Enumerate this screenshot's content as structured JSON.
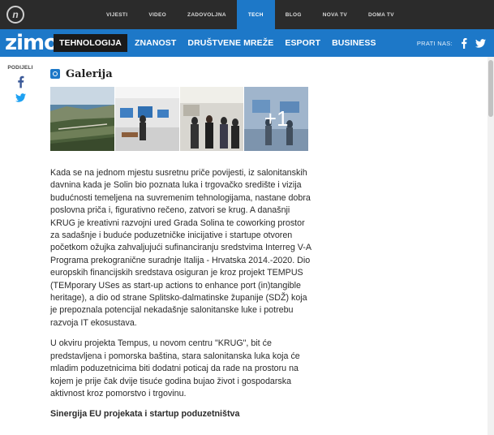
{
  "network": {
    "logo_text": "n",
    "links": [
      {
        "label": "VIJESTI",
        "active": false
      },
      {
        "label": "VIDEO",
        "active": false
      },
      {
        "label": "ZADOVOLJNA",
        "active": false
      },
      {
        "label": "TECH",
        "active": true
      },
      {
        "label": "BLOG",
        "active": false
      },
      {
        "label": "NOVA TV",
        "active": false
      },
      {
        "label": "DOMA TV",
        "active": false
      }
    ]
  },
  "header": {
    "brand": "zimo",
    "sections": [
      {
        "label": "TEHNOLOGIJA",
        "active": true
      },
      {
        "label": "ZNANOST",
        "active": false
      },
      {
        "label": "DRUŠTVENE MREŽE",
        "active": false
      },
      {
        "label": "ESPORT",
        "active": false
      },
      {
        "label": "BUSINESS",
        "active": false
      }
    ],
    "follow_label": "PRATI NAS:",
    "social_icons": [
      "facebook-icon",
      "twitter-icon"
    ]
  },
  "share": {
    "label": "PODIJELI",
    "icons": [
      "facebook-icon",
      "twitter-icon"
    ]
  },
  "gallery": {
    "title": "Galerija",
    "icon": "camera-icon",
    "more_count": "+1"
  },
  "article": {
    "paragraphs": [
      "Kada se na jednom mjestu susretnu priče povijesti, iz salonitanskih davnina kada je Solin bio poznata luka i trgovačko središte i vizija budućnosti temeljena na suvremenim tehnologijama, nastane dobra poslovna priča i, figurativno rečeno, zatvori se krug. A današnji KRUG je kreativni razvojni ured Grada Solina te coworking prostor za sadašnje i buduće poduzetničke inicijative i startupe otvoren početkom ožujka zahvaljujući sufinanciranju sredstvima Interreg V-A Programa prekogranične suradnje Italija - Hrvatska 2014.-2020. Dio europskih financijskih sredstava osiguran je kroz projekt TEMPUS (TEMporary USes as start-up actions to enhance port (in)tangible heritage), a dio od strane Splitsko-dalmatinske županije (SDŽ) koja je prepoznala potencijal nekadašnje salonitanske luke i potrebu razvoja IT ekosustava.",
      "U okviru projekta Tempus, u novom centru \"KRUG\", bit će predstavljena i pomorska baština, stara salonitanska luka koja će mladim poduzetnicima biti dodatni poticaj da rade na prostoru na kojem je prije čak dvije tisuće godina bujao život i gospodarska aktivnost kroz pomorstvo i trgovinu."
    ],
    "subheading": "Sinergija EU projekata i startup poduzetništva"
  },
  "colors": {
    "brand_blue": "#1d78c8",
    "topbar": "#2b2b2b",
    "facebook_share": "#3b5998",
    "twitter_share": "#1da1f2"
  }
}
